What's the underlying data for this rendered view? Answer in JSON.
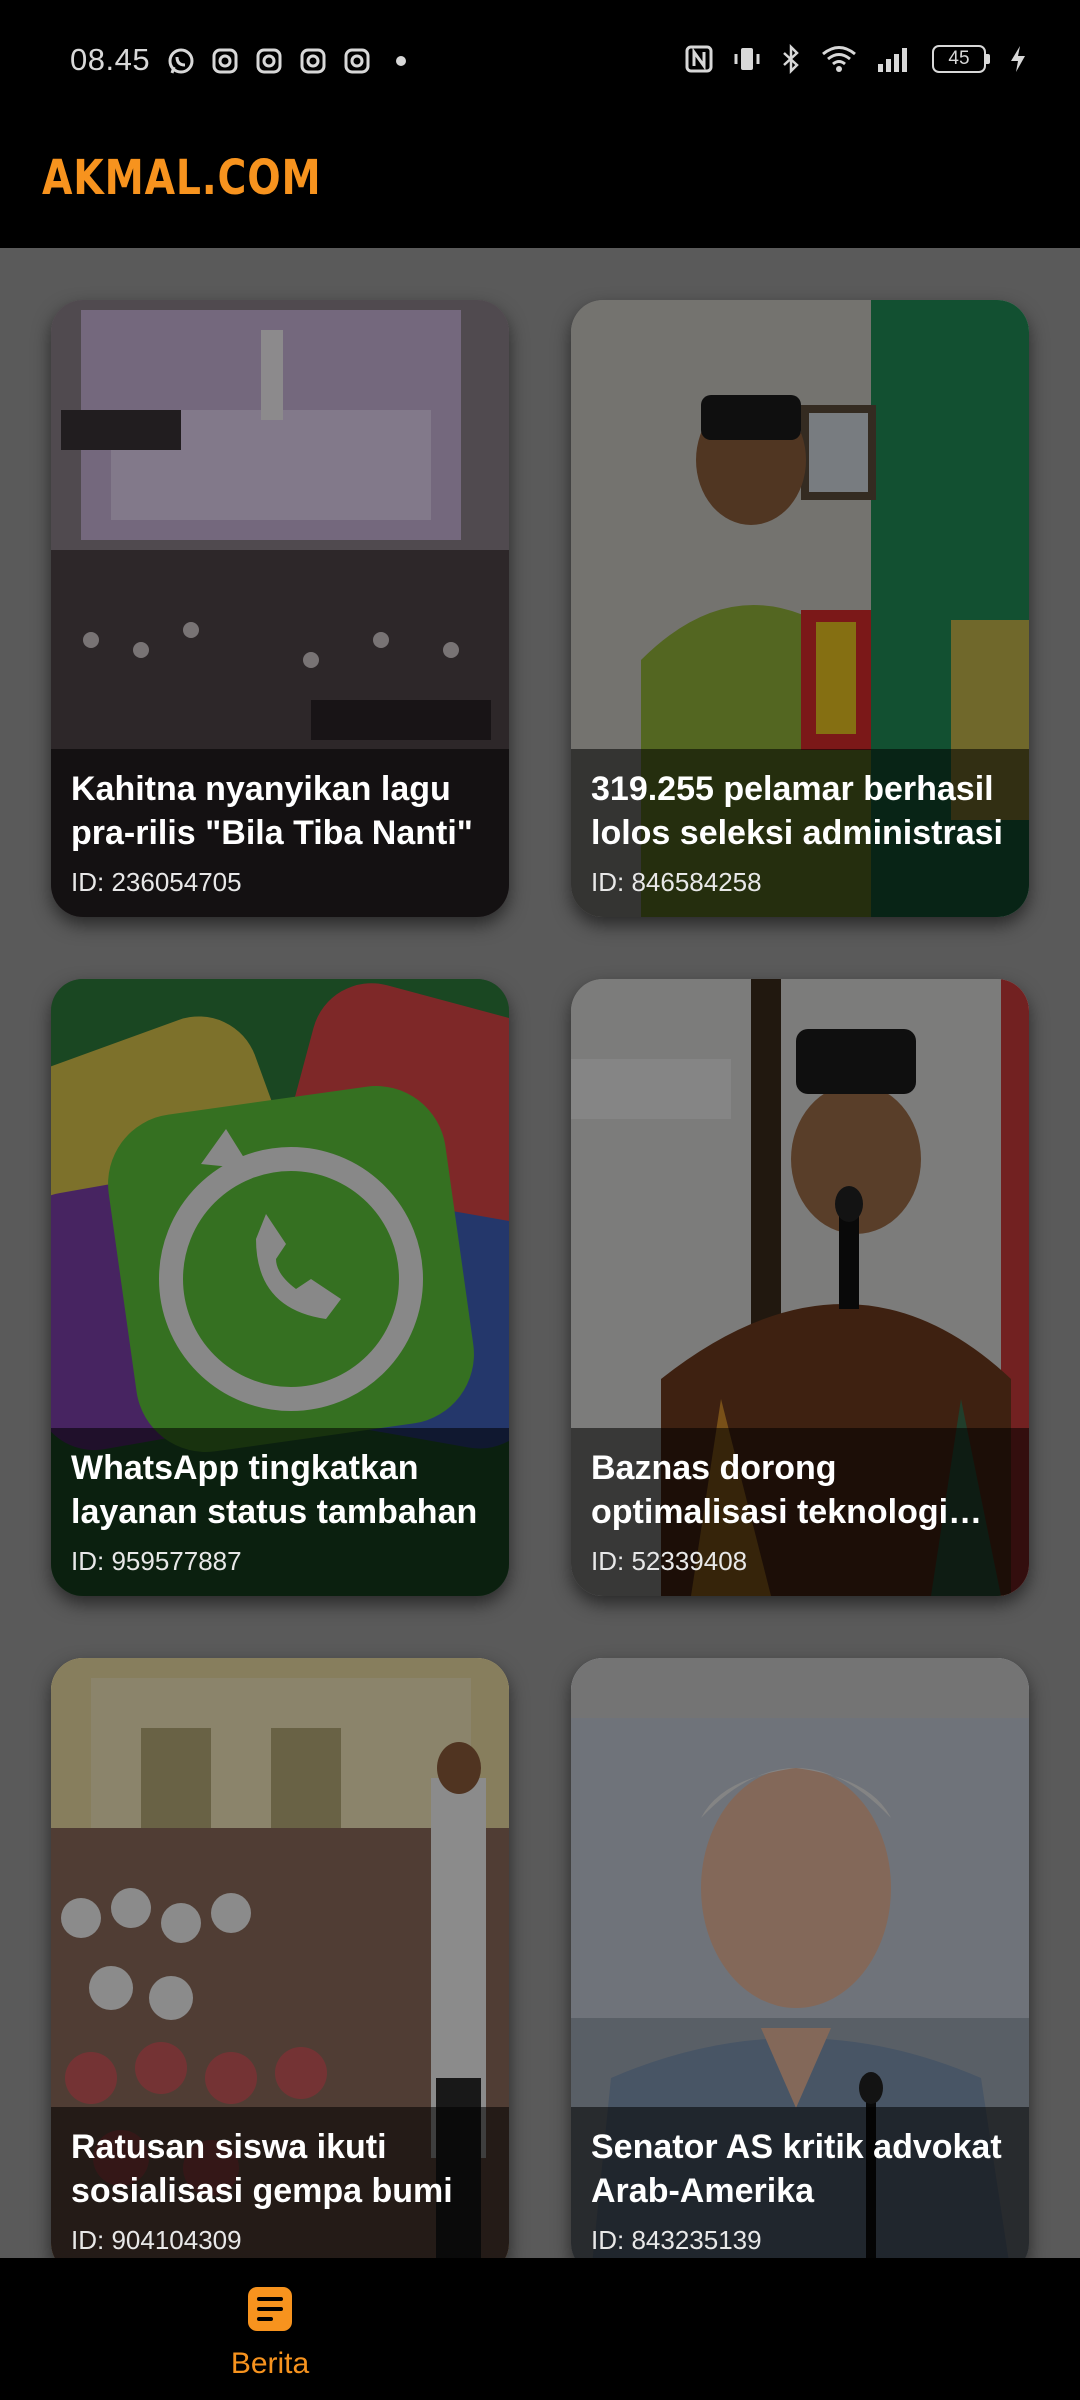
{
  "status_bar": {
    "time": "08.45",
    "battery": "45"
  },
  "app": {
    "logo": "AKMAL.COM",
    "accent_color": "#f7931e"
  },
  "articles": [
    {
      "title": "Kahitna nyanyikan lagu pra-rilis \"Bila Tiba Nanti\"",
      "id": "ID: 236054705",
      "image": "concert-stage-photo"
    },
    {
      "title": "319.255 pelamar berhasil lolos seleksi administrasi",
      "id": "ID: 846584258",
      "image": "official-holding-plaque-photo"
    },
    {
      "title": "WhatsApp tingkatkan layanan status tambahan",
      "id": "ID: 959577887",
      "image": "whatsapp-logo-illustration"
    },
    {
      "title": "Baznas dorong optimalisasi teknologi digital",
      "id": "ID: 52339408",
      "image": "speaker-with-microphone-photo"
    },
    {
      "title": "Ratusan siswa ikuti sosialisasi gempa bumi",
      "id": "ID: 904104309",
      "image": "students-seated-outdoors-photo"
    },
    {
      "title": "Senator AS kritik advokat Arab-Amerika",
      "id": "ID: 843235139",
      "image": "senator-speaking-photo"
    }
  ],
  "bottom_nav": {
    "items": [
      {
        "label": "Berita",
        "icon": "news-icon",
        "active": true
      }
    ]
  }
}
